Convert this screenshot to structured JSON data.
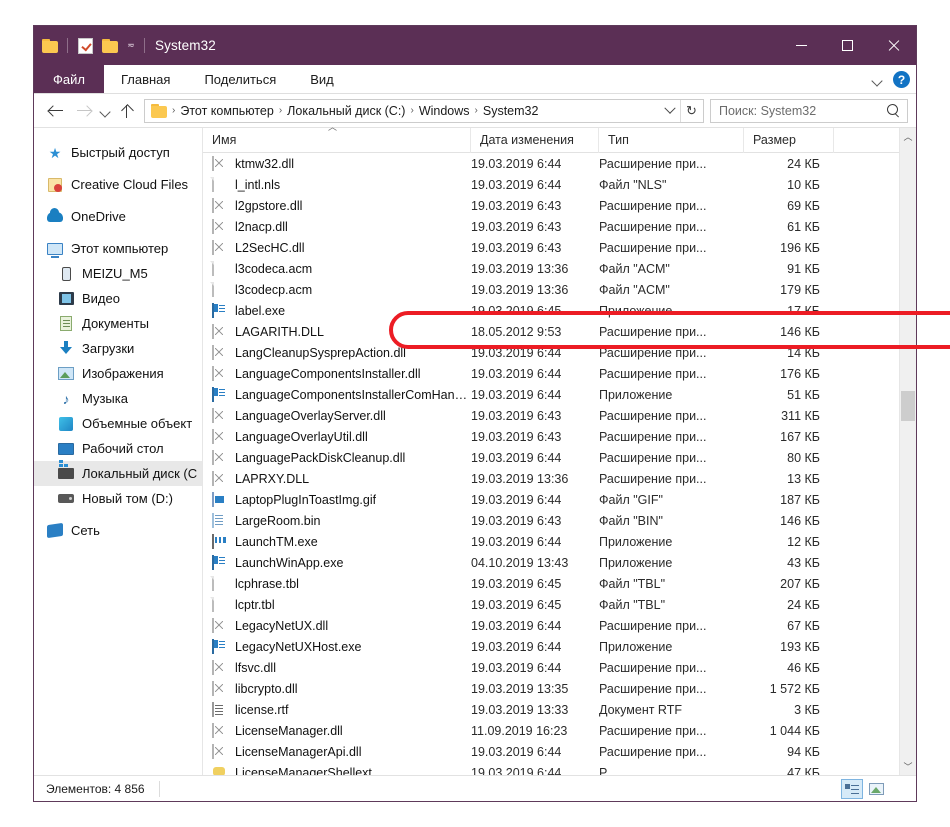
{
  "window": {
    "title": "System32",
    "quick_access": [
      "folder-icon",
      "properties-icon",
      "new-folder-icon",
      "customize-caret-icon"
    ],
    "minimize_label": "Свернуть",
    "maximize_label": "Развернуть",
    "close_label": "Закрыть"
  },
  "ribbon": {
    "tabs": [
      {
        "label": "Файл",
        "active": true
      },
      {
        "label": "Главная",
        "active": false
      },
      {
        "label": "Поделиться",
        "active": false
      },
      {
        "label": "Вид",
        "active": false
      }
    ],
    "expand_label": "⌄",
    "help_label": "?"
  },
  "address": {
    "back_label": "Назад",
    "forward_label": "Вперёд",
    "recent_label": "Последние расположения",
    "up_label": "Вверх",
    "breadcrumbs": [
      "Этот компьютер",
      "Локальный диск (C:)",
      "Windows",
      "System32"
    ],
    "separator": "›",
    "refresh_label": "↻",
    "dropdown_label": "⌄"
  },
  "search": {
    "value": "Поиск: System32",
    "placeholder": "Поиск: System32"
  },
  "sidebar": {
    "items": [
      {
        "label": "Быстрый доступ",
        "icon": "star-icon",
        "indent": false,
        "selected": false
      },
      {
        "label": "Creative Cloud Files",
        "icon": "creative-cloud-icon",
        "indent": false,
        "selected": false
      },
      {
        "label": "OneDrive",
        "icon": "cloud-icon",
        "indent": false,
        "selected": false
      },
      {
        "label": "Этот компьютер",
        "icon": "this-pc-icon",
        "indent": false,
        "selected": false
      },
      {
        "label": "MEIZU_M5",
        "icon": "phone-icon",
        "indent": true,
        "selected": false
      },
      {
        "label": "Видео",
        "icon": "video-icon",
        "indent": true,
        "selected": false
      },
      {
        "label": "Документы",
        "icon": "documents-icon",
        "indent": true,
        "selected": false
      },
      {
        "label": "Загрузки",
        "icon": "downloads-icon",
        "indent": true,
        "selected": false
      },
      {
        "label": "Изображения",
        "icon": "pictures-icon",
        "indent": true,
        "selected": false
      },
      {
        "label": "Музыка",
        "icon": "music-icon",
        "indent": true,
        "selected": false
      },
      {
        "label": "Объемные объект",
        "icon": "3d-objects-icon",
        "indent": true,
        "selected": false
      },
      {
        "label": "Рабочий стол",
        "icon": "desktop-icon",
        "indent": true,
        "selected": false
      },
      {
        "label": "Локальный диск (C",
        "icon": "local-disk-icon",
        "indent": true,
        "selected": true
      },
      {
        "label": "Новый том (D:)",
        "icon": "volume-icon",
        "indent": true,
        "selected": false
      },
      {
        "label": "Сеть",
        "icon": "network-icon",
        "indent": false,
        "selected": false
      }
    ]
  },
  "columns": [
    {
      "label": "Имя",
      "sorted": true,
      "sort_dir": "asc"
    },
    {
      "label": "Дата изменения",
      "sorted": false
    },
    {
      "label": "Тип",
      "sorted": false
    },
    {
      "label": "Размер",
      "sorted": false
    }
  ],
  "files": [
    {
      "name": "ktmw32.dll",
      "date": "19.03.2019 6:44",
      "type": "Расширение при...",
      "size": "24 КБ",
      "icon": "fi-dll"
    },
    {
      "name": "l_intl.nls",
      "date": "19.03.2019 6:44",
      "type": "Файл \"NLS\"",
      "size": "10 КБ",
      "icon": "fi-plain"
    },
    {
      "name": "l2gpstore.dll",
      "date": "19.03.2019 6:43",
      "type": "Расширение при...",
      "size": "69 КБ",
      "icon": "fi-dll"
    },
    {
      "name": "l2nacp.dll",
      "date": "19.03.2019 6:43",
      "type": "Расширение при...",
      "size": "61 КБ",
      "icon": "fi-dll",
      "highlighted": true
    },
    {
      "name": "L2SecHC.dll",
      "date": "19.03.2019 6:43",
      "type": "Расширение при...",
      "size": "196 КБ",
      "icon": "fi-dll"
    },
    {
      "name": "l3codeca.acm",
      "date": "19.03.2019 13:36",
      "type": "Файл \"ACM\"",
      "size": "91 КБ",
      "icon": "fi-plain"
    },
    {
      "name": "l3codecp.acm",
      "date": "19.03.2019 13:36",
      "type": "Файл \"ACM\"",
      "size": "179 КБ",
      "icon": "fi-plain"
    },
    {
      "name": "label.exe",
      "date": "19.03.2019 6:45",
      "type": "Приложение",
      "size": "17 КБ",
      "icon": "fi-exe"
    },
    {
      "name": "LAGARITH.DLL",
      "date": "18.05.2012 9:53",
      "type": "Расширение при...",
      "size": "146 КБ",
      "icon": "fi-dll"
    },
    {
      "name": "LangCleanupSysprepAction.dll",
      "date": "19.03.2019 6:44",
      "type": "Расширение при...",
      "size": "14 КБ",
      "icon": "fi-dll"
    },
    {
      "name": "LanguageComponentsInstaller.dll",
      "date": "19.03.2019 6:44",
      "type": "Расширение при...",
      "size": "176 КБ",
      "icon": "fi-dll"
    },
    {
      "name": "LanguageComponentsInstallerComHand...",
      "date": "19.03.2019 6:44",
      "type": "Приложение",
      "size": "51 КБ",
      "icon": "fi-exe"
    },
    {
      "name": "LanguageOverlayServer.dll",
      "date": "19.03.2019 6:43",
      "type": "Расширение при...",
      "size": "311 КБ",
      "icon": "fi-dll"
    },
    {
      "name": "LanguageOverlayUtil.dll",
      "date": "19.03.2019 6:43",
      "type": "Расширение при...",
      "size": "167 КБ",
      "icon": "fi-dll"
    },
    {
      "name": "LanguagePackDiskCleanup.dll",
      "date": "19.03.2019 6:44",
      "type": "Расширение при...",
      "size": "80 КБ",
      "icon": "fi-dll"
    },
    {
      "name": "LAPRXY.DLL",
      "date": "19.03.2019 13:36",
      "type": "Расширение при...",
      "size": "13 КБ",
      "icon": "fi-dll"
    },
    {
      "name": "LaptopPlugInToastImg.gif",
      "date": "19.03.2019 6:44",
      "type": "Файл \"GIF\"",
      "size": "187 КБ",
      "icon": "fi-gif"
    },
    {
      "name": "LargeRoom.bin",
      "date": "19.03.2019 6:43",
      "type": "Файл \"BIN\"",
      "size": "146 КБ",
      "icon": "fi-bin"
    },
    {
      "name": "LaunchTM.exe",
      "date": "19.03.2019 6:44",
      "type": "Приложение",
      "size": "12 КБ",
      "icon": "fi-tm"
    },
    {
      "name": "LaunchWinApp.exe",
      "date": "04.10.2019 13:43",
      "type": "Приложение",
      "size": "43 КБ",
      "icon": "fi-exe"
    },
    {
      "name": "lcphrase.tbl",
      "date": "19.03.2019 6:45",
      "type": "Файл \"TBL\"",
      "size": "207 КБ",
      "icon": "fi-plain"
    },
    {
      "name": "lcptr.tbl",
      "date": "19.03.2019 6:45",
      "type": "Файл \"TBL\"",
      "size": "24 КБ",
      "icon": "fi-plain"
    },
    {
      "name": "LegacyNetUX.dll",
      "date": "19.03.2019 6:44",
      "type": "Расширение при...",
      "size": "67 КБ",
      "icon": "fi-dll"
    },
    {
      "name": "LegacyNetUXHost.exe",
      "date": "19.03.2019 6:44",
      "type": "Приложение",
      "size": "193 КБ",
      "icon": "fi-exe"
    },
    {
      "name": "lfsvc.dll",
      "date": "19.03.2019 6:44",
      "type": "Расширение при...",
      "size": "46 КБ",
      "icon": "fi-dll"
    },
    {
      "name": "libcrypto.dll",
      "date": "19.03.2019 13:35",
      "type": "Расширение при...",
      "size": "1 572 КБ",
      "icon": "fi-dll"
    },
    {
      "name": "license.rtf",
      "date": "19.03.2019 13:33",
      "type": "Документ RTF",
      "size": "3 КБ",
      "icon": "fi-rtf"
    },
    {
      "name": "LicenseManager.dll",
      "date": "11.09.2019 16:23",
      "type": "Расширение при...",
      "size": "1 044 КБ",
      "icon": "fi-dll"
    },
    {
      "name": "LicenseManagerApi.dll",
      "date": "19.03.2019 6:44",
      "type": "Расширение при...",
      "size": "94 КБ",
      "icon": "fi-dll"
    },
    {
      "name": "LicenseManagerShellext",
      "date": "19.03.2019 6:44",
      "type": "Р",
      "size": "47 КБ",
      "icon": "fi-shell"
    }
  ],
  "status": {
    "item_count": "Элементов: 4 856"
  },
  "view_buttons": {
    "details_label": "Таблица",
    "thumbnails_label": "Крупные значки"
  },
  "colors": {
    "titlebar": "#5b2f55",
    "accent_red": "#ec1c24",
    "selection": "#e8e8e8",
    "folder_yellow": "#fbc850",
    "help_blue": "#1273c4"
  }
}
